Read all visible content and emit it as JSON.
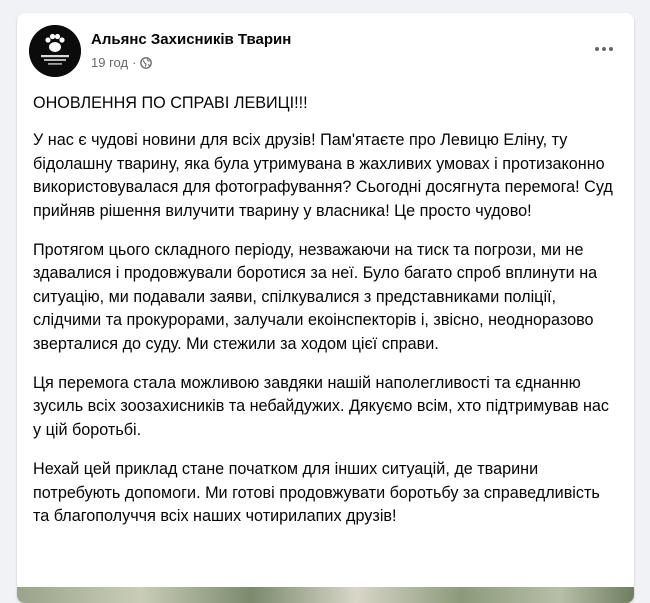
{
  "post": {
    "author": "Альянс Захисників Тварин",
    "time": "19 год",
    "separator": "·",
    "audience_icon": "globe-icon",
    "more_icon": "more-horizontal-icon",
    "avatar_logo_text": "Альянс Захисників Тварин",
    "headline": "ОНОВЛЕННЯ ПО СПРАВІ ЛЕВИЦІ!!!",
    "paragraphs": [
      "У нас є чудові новини для всіх друзів! Пам'ятаєте про Левицю Еліну, ту бідолашну тварину, яка була утримувана в жахливих умовах і протизаконно використовувалася для фотографування? Сьогодні досягнута перемога! Суд прийняв рішення вилучити тварину у власника! Це просто чудово!",
      "Протягом цього складного періоду, незважаючи на тиск та погрози, ми не здавалися і продовжували боротися за неї. Було багато спроб вплинути на ситуацію, ми подавали заяви, спілкувалися з представниками поліції, слідчими та прокурорами, залучали екоінспекторів і, звісно, неодноразово зверталися до суду. Ми стежили за ходом цієї справи.",
      "Ця перемога стала можливою завдяки нашій наполегливості та єднанню зусиль всіх зоозахисників та небайдужих. Дякуємо всім, хто підтримував нас у цій боротьбі.",
      "Нехай цей приклад стане початком для інших ситуацій, де тварини потребують допомоги. Ми готові продовжувати боротьбу за справедливість та благополуччя всіх наших чотирилапих друзів!"
    ]
  },
  "colors": {
    "page_bg": "#f0f2f5",
    "card_bg": "#ffffff",
    "text_primary": "#050505",
    "text_secondary": "#65676b"
  }
}
